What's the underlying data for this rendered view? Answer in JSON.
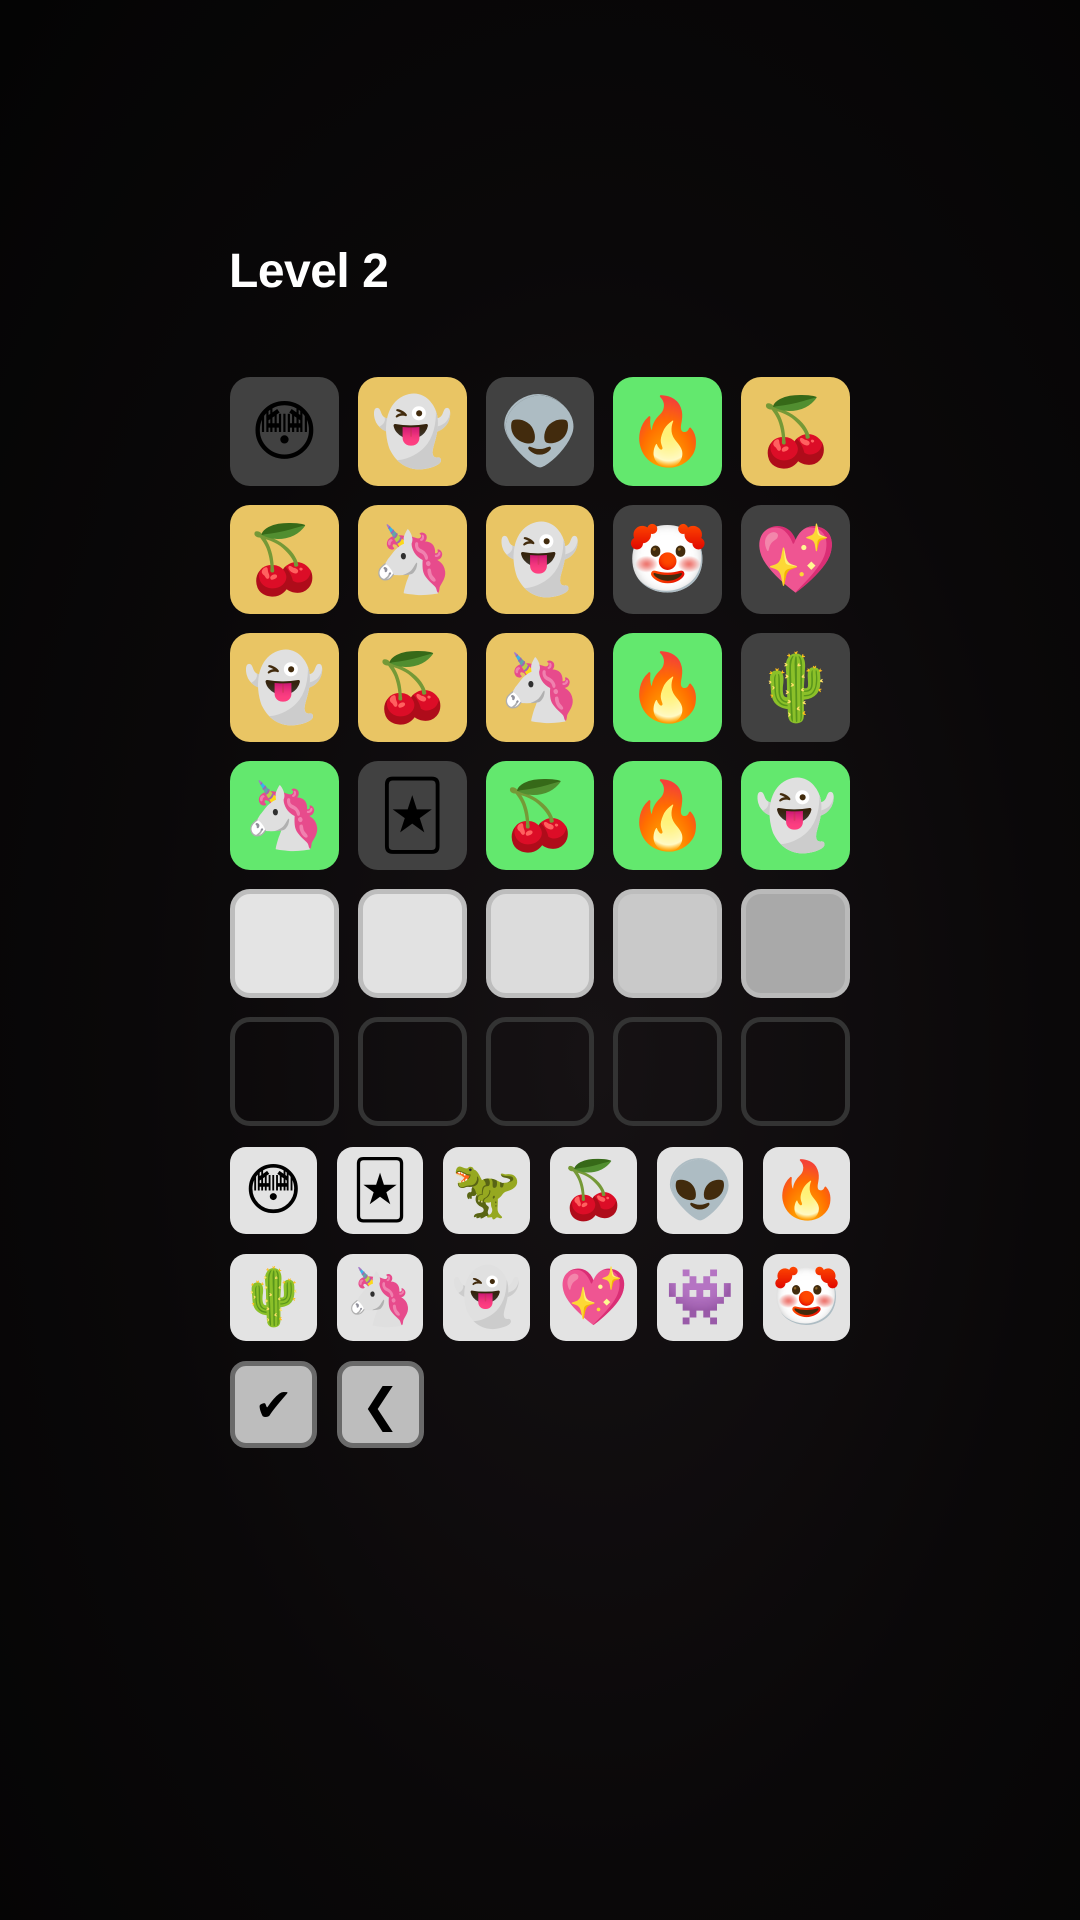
{
  "header": {
    "title": "Level 2"
  },
  "colors": {
    "gray": "#414141",
    "yellow": "#e9c564",
    "green": "#63e86e",
    "key": "#e3e3e3",
    "background": "#0a0809"
  },
  "board": {
    "rows": [
      [
        {
          "emoji": "😳",
          "state": "gray",
          "name": "flushed-face"
        },
        {
          "emoji": "👻",
          "state": "yellow",
          "name": "ghost"
        },
        {
          "emoji": "👽",
          "state": "gray",
          "name": "alien"
        },
        {
          "emoji": "🔥",
          "state": "green",
          "name": "fire"
        },
        {
          "emoji": "🍒",
          "state": "yellow",
          "name": "cherries"
        }
      ],
      [
        {
          "emoji": "🍒",
          "state": "yellow",
          "name": "cherries"
        },
        {
          "emoji": "🦄",
          "state": "yellow",
          "name": "unicorn"
        },
        {
          "emoji": "👻",
          "state": "yellow",
          "name": "ghost"
        },
        {
          "emoji": "🤡",
          "state": "gray",
          "name": "clown-face"
        },
        {
          "emoji": "💖",
          "state": "gray",
          "name": "sparkling-heart"
        }
      ],
      [
        {
          "emoji": "👻",
          "state": "yellow",
          "name": "ghost"
        },
        {
          "emoji": "🍒",
          "state": "yellow",
          "name": "cherries"
        },
        {
          "emoji": "🦄",
          "state": "yellow",
          "name": "unicorn"
        },
        {
          "emoji": "🔥",
          "state": "green",
          "name": "fire"
        },
        {
          "emoji": "🌵",
          "state": "gray",
          "name": "cactus"
        }
      ],
      [
        {
          "emoji": "🦄",
          "state": "green",
          "name": "unicorn"
        },
        {
          "emoji": "🃏",
          "state": "gray",
          "name": "joker"
        },
        {
          "emoji": "🍒",
          "state": "green",
          "name": "cherries"
        },
        {
          "emoji": "🔥",
          "state": "green",
          "name": "fire"
        },
        {
          "emoji": "👻",
          "state": "green",
          "name": "ghost"
        }
      ],
      [
        {
          "emoji": "",
          "state": "input",
          "name": "input-slot"
        },
        {
          "emoji": "",
          "state": "input",
          "name": "input-slot"
        },
        {
          "emoji": "",
          "state": "input",
          "name": "input-slot"
        },
        {
          "emoji": "",
          "state": "input",
          "name": "input-slot"
        },
        {
          "emoji": "",
          "state": "input",
          "name": "input-slot"
        }
      ],
      [
        {
          "emoji": "",
          "state": "empty",
          "name": "empty-slot"
        },
        {
          "emoji": "",
          "state": "empty",
          "name": "empty-slot"
        },
        {
          "emoji": "",
          "state": "empty",
          "name": "empty-slot"
        },
        {
          "emoji": "",
          "state": "empty",
          "name": "empty-slot"
        },
        {
          "emoji": "",
          "state": "empty",
          "name": "empty-slot"
        }
      ]
    ]
  },
  "keyboard": {
    "rows": [
      [
        {
          "emoji": "😳",
          "name": "flushed-face"
        },
        {
          "emoji": "🃏",
          "name": "joker"
        },
        {
          "emoji": "🦖",
          "name": "t-rex"
        },
        {
          "emoji": "🍒",
          "name": "cherries"
        },
        {
          "emoji": "👽",
          "name": "alien"
        },
        {
          "emoji": "🔥",
          "name": "fire"
        }
      ],
      [
        {
          "emoji": "🌵",
          "name": "cactus"
        },
        {
          "emoji": "🦄",
          "name": "unicorn"
        },
        {
          "emoji": "👻",
          "name": "ghost"
        },
        {
          "emoji": "💖",
          "name": "sparkling-heart"
        },
        {
          "emoji": "👾",
          "name": "alien-monster"
        },
        {
          "emoji": "🤡",
          "name": "clown-face"
        }
      ]
    ],
    "actions": {
      "submit_label": "✔",
      "back_label": "❮"
    }
  }
}
